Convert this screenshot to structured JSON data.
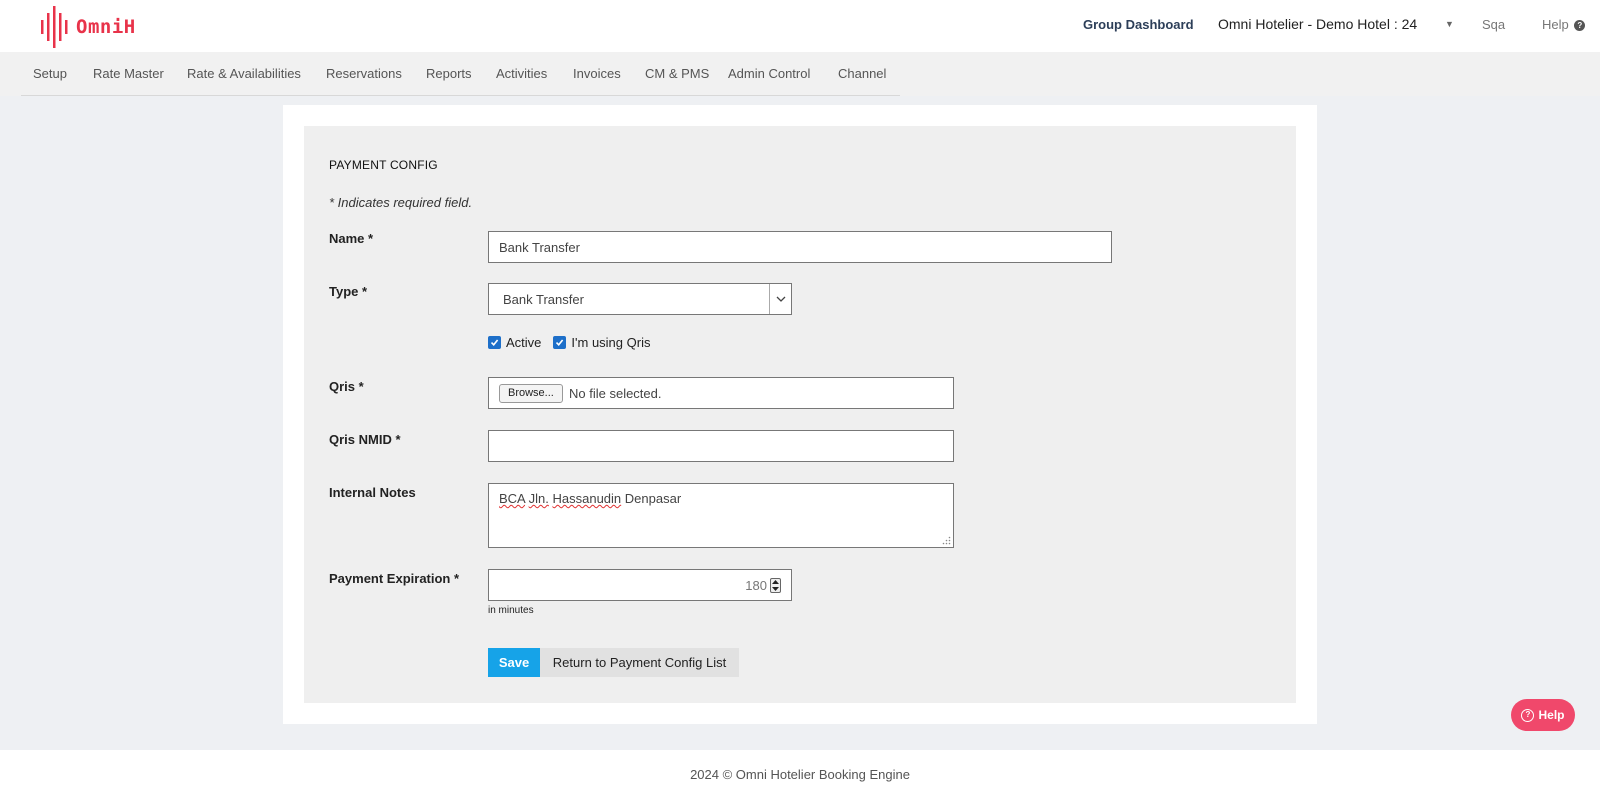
{
  "header": {
    "logo_text": "OmniH",
    "group_dashboard": "Group Dashboard",
    "hotel_selector": "Omni Hotelier - Demo Hotel : 24",
    "user": "Sqa",
    "help": "Help"
  },
  "nav": {
    "items": [
      "Setup",
      "Rate Master",
      "Rate & Availabilities",
      "Reservations",
      "Reports",
      "Activities",
      "Invoices",
      "CM & PMS",
      "Admin Control",
      "Channel"
    ]
  },
  "form": {
    "title": "PAYMENT CONFIG",
    "required_note": "* Indicates required field.",
    "name_label": "Name *",
    "name_value": "Bank Transfer",
    "type_label": "Type *",
    "type_value": "Bank Transfer",
    "active_label": "Active",
    "active_checked": true,
    "qris_toggle_label": "I'm using Qris",
    "qris_toggle_checked": true,
    "qris_label": "Qris *",
    "browse_label": "Browse...",
    "file_status": "No file selected.",
    "qris_nmid_label": "Qris NMID *",
    "qris_nmid_value": "",
    "notes_label": "Internal Notes",
    "notes_word1": "BCA",
    "notes_word2": "Jln.",
    "notes_word3": "Hassanudin",
    "notes_word4": "Denpasar",
    "expiration_label": "Payment Expiration *",
    "expiration_value": "180",
    "expiration_unit": "in minutes",
    "save_label": "Save",
    "return_label": "Return to Payment Config List"
  },
  "help_button": "Help",
  "footer": "2024 © Omni Hotelier Booking Engine",
  "colors": {
    "brand": "#e8334a",
    "primary": "#16a3e8",
    "help_button": "#f0486b",
    "checkbox": "#1d6fc9"
  }
}
